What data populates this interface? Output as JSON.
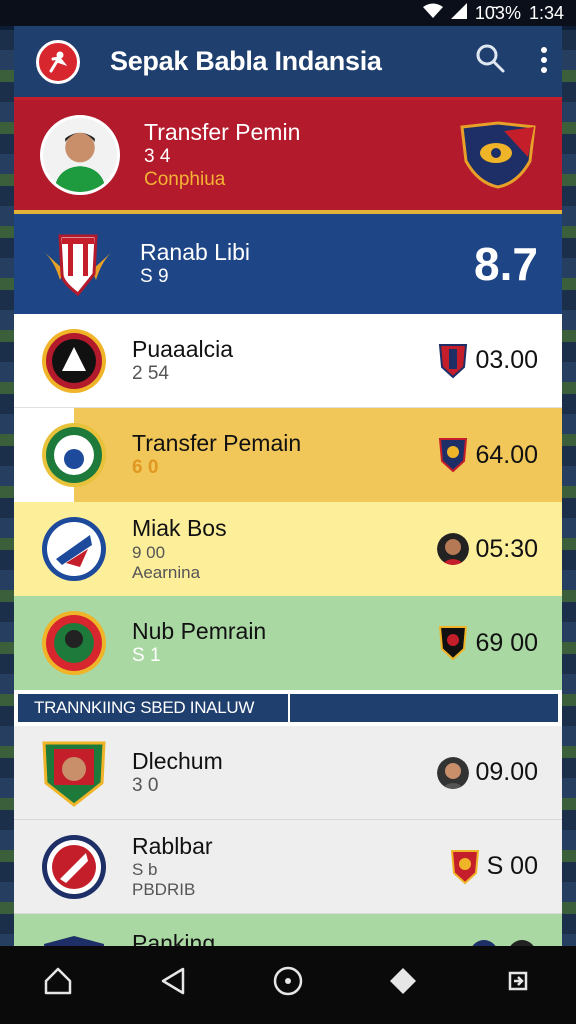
{
  "status_bar": {
    "battery": "10̄3%",
    "time": "1:34"
  },
  "app_bar": {
    "title": "Sepak Babla Indansia",
    "logo_icon": "brand-logo"
  },
  "rows": [
    {
      "name": "Transfer Pemin",
      "sub": "3 4",
      "sub2": "Conphiua"
    },
    {
      "name": "Ranab Libi",
      "sub": "S 9",
      "score": "8.7"
    },
    {
      "name": "Puaaalcia",
      "sub": "2 54",
      "value": "03.00"
    },
    {
      "name": "Transfer Pemain",
      "sub": "6 0",
      "value": "64.00"
    },
    {
      "name": "Miak Bos",
      "sub": "9 00",
      "sub2": "Aearnina",
      "value": "05:30"
    },
    {
      "name": "Nub Pemrain",
      "sub": "S 1",
      "value": "69 00"
    }
  ],
  "section": {
    "title": "TRANNKIING SBED INALUW"
  },
  "rows2": [
    {
      "name": "Dlechum",
      "sub": "3 0",
      "value": "09.00"
    },
    {
      "name": "Rablbar",
      "sub": "S b",
      "sub2": "PBDRIB",
      "value": "S 00"
    },
    {
      "name": "Panking"
    }
  ],
  "colors": {
    "app_bar": "#1f3f6e",
    "hero_red": "#b31a2c",
    "hero_blue": "#1e4585",
    "orange": "#f1c75a",
    "yellow": "#fdee9a",
    "green": "#a9d8a3"
  }
}
